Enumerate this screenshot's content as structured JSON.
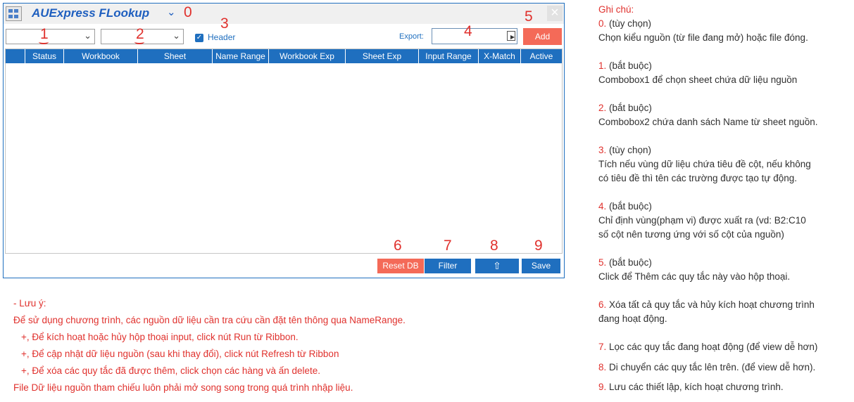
{
  "dialog": {
    "title": "AUExpress FLookup",
    "header_checkbox_label": "Header",
    "header_checked": true,
    "export_label": "Export:",
    "export_value": "",
    "add_button": "Add",
    "columns": [
      "",
      "Status",
      "Workbook",
      "Sheet",
      "Name Range",
      "Workbook Exp",
      "Sheet Exp",
      "Input Range",
      "X-Match",
      "Active"
    ],
    "reset_button": "Reset DB",
    "filter_button": "Filter",
    "move_up_icon": "arrow-up-icon",
    "save_button": "Save",
    "close_icon": "close-icon"
  },
  "callouts": [
    "0",
    "1",
    "2",
    "3",
    "4",
    "5",
    "6",
    "7",
    "8",
    "9"
  ],
  "notes": {
    "heading": "Ghi chú:",
    "items": [
      {
        "num": "0.",
        "tag": "(tùy chọn)",
        "lines": [
          "Chọn kiểu nguồn (từ file đang mở) hoặc file đóng."
        ]
      },
      {
        "num": "1.",
        "tag": "(bắt buộc)",
        "lines": [
          "Combobox1 để chọn sheet chứa dữ liệu nguồn"
        ]
      },
      {
        "num": "2.",
        "tag": "(bắt buộc)",
        "lines": [
          "Combobox2 chứa danh sách Name từ sheet nguồn."
        ]
      },
      {
        "num": "3.",
        "tag": "(tùy chọn)",
        "lines": [
          "Tích nếu vùng dữ liệu chứa tiêu đề cột, nếu không",
          "có tiêu đề thì tên các trường được tạo tự động."
        ]
      },
      {
        "num": "4.",
        "tag": "(bắt buộc)",
        "lines": [
          "Chỉ định vùng(phạm vi) được xuất ra (vd: B2:C10",
          "số cột nên tương ứng với số cột của nguồn)"
        ]
      },
      {
        "num": "5.",
        "tag": "(bắt buộc)",
        "lines": [
          "Click để Thêm các quy tắc này vào hộp thoại."
        ]
      },
      {
        "num": "6.",
        "text": "Xóa tất cả quy tắc và hủy kích hoạt chương trình",
        "lines": [
          "đang hoạt động."
        ]
      },
      {
        "num": "7.",
        "text": "Lọc các quy tắc đang hoạt động (để view dễ hơn)",
        "lines": []
      },
      {
        "num": "8.",
        "text": "Di chuyển các quy tắc lên trên. (để view dễ hơn).",
        "lines": []
      },
      {
        "num": "9.",
        "text": "Lưu các thiết lập, kích hoạt chương trình.",
        "lines": []
      }
    ]
  },
  "warning": {
    "title": "- Lưu ý:",
    "lines": [
      "Để sử dụng chương trình, các nguồn dữ liệu cần tra cứu cần đặt tên thông qua NameRange.",
      "+, Để kích hoạt hoặc hủy hộp thoại input, click nút Run từ Ribbon.",
      "+, Để cập nhật dữ liệu nguồn (sau khi thay đổi), click nút Refresh từ Ribbon",
      "+, Để xóa các quy tắc đã được thêm, click chọn các hàng và ấn delete.",
      "File Dữ liệu nguồn tham chiếu luôn phải mở song song trong quá trình nhập liệu."
    ]
  }
}
